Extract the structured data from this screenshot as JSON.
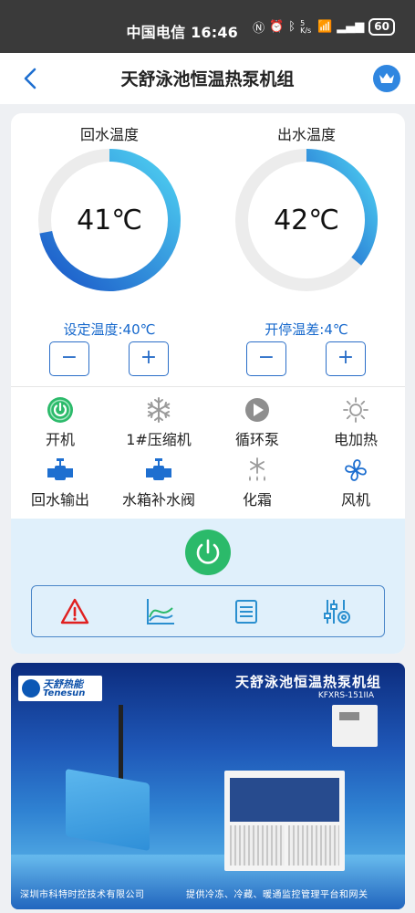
{
  "status_bar": {
    "carrier": "中国电信",
    "time": "16:46",
    "net_speed": "5 K/s",
    "battery": "60"
  },
  "header": {
    "title": "天舒泳池恒温热泵机组"
  },
  "gauges": {
    "return": {
      "title": "回水温度",
      "value": "41℃",
      "setting": "设定温度:40℃",
      "fill_fraction": 0.72
    },
    "outlet": {
      "title": "出水温度",
      "value": "42℃",
      "setting": "开停温差:4℃",
      "fill_fraction": 0.36
    }
  },
  "stepper": {
    "minus": "−",
    "plus": "+"
  },
  "status_items": [
    {
      "label": "开机",
      "icon": "power-on-icon",
      "active": true
    },
    {
      "label": "1#压缩机",
      "icon": "snowflake-icon",
      "active": false
    },
    {
      "label": "循环泵",
      "icon": "pump-icon",
      "active": false
    },
    {
      "label": "电加热",
      "icon": "sun-icon",
      "active": false
    },
    {
      "label": "回水输出",
      "icon": "valve-icon",
      "active": true
    },
    {
      "label": "水箱补水阀",
      "icon": "valve-icon",
      "active": true
    },
    {
      "label": "化霜",
      "icon": "defrost-icon",
      "active": false
    },
    {
      "label": "风机",
      "icon": "fan-icon",
      "active": true
    }
  ],
  "toolbar": [
    "warning-icon",
    "chart-icon",
    "list-icon",
    "settings-sliders-icon"
  ],
  "banner": {
    "logo_cn": "天舒热能",
    "logo_en": "Tenesun",
    "title": "天舒泳池恒温热泵机组",
    "model": "KFXRS-151IIA",
    "footer_left": "深圳市科特时控技术有限公司",
    "footer_right": "提供冷冻、冷藏、暖通监控管理平台和网关"
  },
  "colors": {
    "accent": "#1668cc",
    "gauge_start": "#1a57c8",
    "gauge_end": "#4fd2f2",
    "power_green": "#2bba6a",
    "alarm_red": "#e02020"
  }
}
